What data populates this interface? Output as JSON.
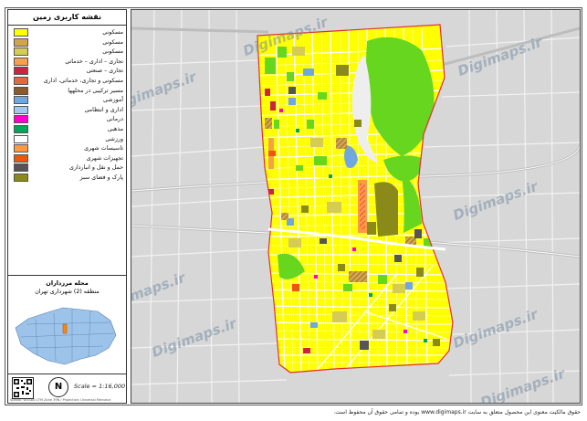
{
  "legend": {
    "title": "نقشه کاربری زمین",
    "items": [
      {
        "label": "مسکونی",
        "color": "#ffff00"
      },
      {
        "label": "مسکونی",
        "color": "#d1a54a"
      },
      {
        "label": "مسکونی",
        "color": "#d4cc54"
      },
      {
        "label": "تجاری – اداری – خدماتی",
        "color": "#f6a04d"
      },
      {
        "label": "تجاری – صنعتی",
        "color": "#cc2244"
      },
      {
        "label": "مسکونی و تجاری، خدماتی، اداری",
        "color": "#e06a3a"
      },
      {
        "label": "مسیر ترکیبی در محلهها",
        "color": "#8a5a2a"
      },
      {
        "label": "آموزشی",
        "color": "#6fa8e0"
      },
      {
        "label": "اداری و انتظامی",
        "color": "#a0c8f0"
      },
      {
        "label": "درمانی",
        "color": "#ff00cc"
      },
      {
        "label": "مذهبی",
        "color": "#00a65a"
      },
      {
        "label": "ورزشی",
        "color": "#ffffff"
      },
      {
        "label": "تاسیسات شهری",
        "color": "#ff9944"
      },
      {
        "label": "تجهیزات شهری",
        "color": "#ee5511"
      },
      {
        "label": "حمل و نقل و انبارداری",
        "color": "#555555"
      },
      {
        "label": "پارک و فضای سبز",
        "color": "#8a8a1a"
      }
    ]
  },
  "locality": {
    "title": "محله مرزداران",
    "region": "منطقه (2) شهرداری تهران"
  },
  "scale": "Scale = 1:16,000",
  "credit": "Spatial: WGS84 UTM Zone 39N / Projection: Universal Mercator",
  "watermark": "Digimaps.ir",
  "copyright": "حقوق مالکیت معنوی این محصول متعلق به سایت www.digimaps.ir بوده و تمامی حقوق آن محفوظ است.",
  "colors": {
    "residential": "#ffff00",
    "green": "#66d61e",
    "road": "#ffffff",
    "background": "#d7d7d7",
    "boundary": "#e03030",
    "water": "#6fa8e0"
  }
}
